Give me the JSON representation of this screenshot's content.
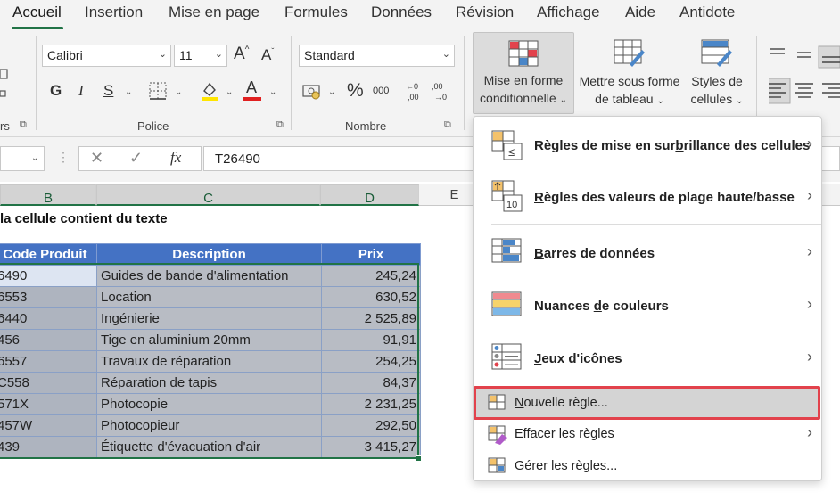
{
  "tabs": [
    "Accueil",
    "Insertion",
    "Mise en page",
    "Formules",
    "Données",
    "Révision",
    "Affichage",
    "Aide",
    "Antidote"
  ],
  "ribbon": {
    "font_name": "Calibri",
    "font_size": "11",
    "grow_font": "A",
    "shrink_font": "A",
    "bold": "G",
    "italic": "I",
    "underline": "S",
    "font_color_letter": "A",
    "number_format": "Standard",
    "percent": "%",
    "thousands": "000",
    "group_clipboard_partial": "rs",
    "group_police": "Police",
    "group_nombre": "Nombre",
    "mise_en_forme_line1": "Mise en forme",
    "mise_en_forme_line2": "conditionnelle",
    "mettre_sous_forme_line1": "Mettre sous forme",
    "mettre_sous_forme_line2": "de tableau",
    "styles_line1": "Styles de",
    "styles_line2": "cellules",
    "colors": {
      "highlight": "#ffe500",
      "font_color": "#e02020",
      "accent": "#217346"
    }
  },
  "formula_bar": {
    "cancel_symbol": "✕",
    "enter_symbol": "✓",
    "fx_label": "fx",
    "value": "T26490"
  },
  "columns": [
    "B",
    "C",
    "D",
    "E"
  ],
  "sheet": {
    "title": "la cellule contient du texte",
    "headers": [
      "Code Produit",
      "Description",
      "Prix"
    ],
    "rows": [
      [
        "6490",
        "Guides de bande d'alimentation",
        "245,24"
      ],
      [
        "6553",
        "Location",
        "630,52"
      ],
      [
        "6440",
        "Ingénierie",
        "2 525,89"
      ],
      [
        "456",
        "Tige en aluminium 20mm",
        "91,91"
      ],
      [
        "6557",
        "Travaux de réparation",
        "254,25"
      ],
      [
        "C558",
        "Réparation de tapis",
        "84,37"
      ],
      [
        "571X",
        "Photocopie",
        "2 231,25"
      ],
      [
        "457W",
        "Photocopieur",
        "292,50"
      ],
      [
        "439",
        "Étiquette d'évacuation d'air",
        "3 415,27"
      ]
    ]
  },
  "menu": {
    "items": [
      {
        "pre": "Règles de mise en sur",
        "key": "b",
        "post": "rillance des cellules"
      },
      {
        "pre": "",
        "key": "R",
        "post": "ègles des valeurs de plage haute/basse",
        "icon_number": "10"
      },
      {
        "pre": "",
        "key": "B",
        "post": "arres de données"
      },
      {
        "pre": "Nuances ",
        "key": "d",
        "post": "e couleurs"
      },
      {
        "pre": "",
        "key": "J",
        "post": "eux d'icônes"
      },
      {
        "pre": "",
        "key": "N",
        "post": "ouvelle règle..."
      },
      {
        "pre": "Effa",
        "key": "c",
        "post": "er les règles"
      },
      {
        "pre": "",
        "key": "G",
        "post": "érer les règles..."
      }
    ],
    "arrow": "›"
  }
}
